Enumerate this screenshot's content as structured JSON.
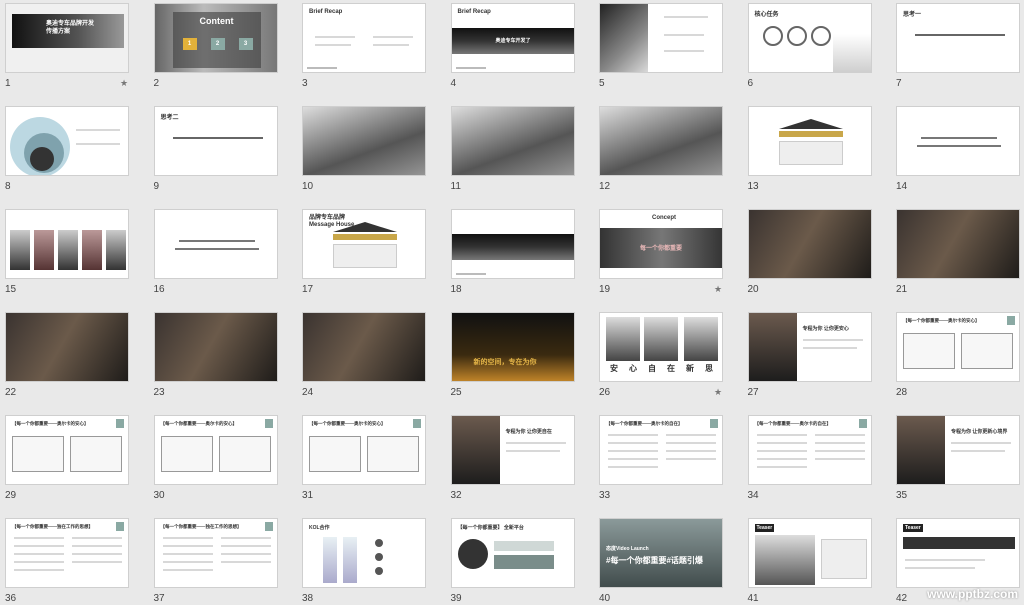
{
  "slides": [
    {
      "n": "1",
      "title": "奥迪专车品牌开发\n传播方案",
      "star": true,
      "kind": "cover"
    },
    {
      "n": "2",
      "title": "Content",
      "kind": "content",
      "items": [
        "1",
        "2",
        "3"
      ]
    },
    {
      "n": "3",
      "title": "Brief Recap",
      "kind": "brief"
    },
    {
      "n": "4",
      "title": "Brief Recap",
      "kind": "brief-car",
      "caption": "奥迪专车开发了"
    },
    {
      "n": "5",
      "kind": "photo-left"
    },
    {
      "n": "6",
      "title": "核心任务",
      "kind": "circles"
    },
    {
      "n": "7",
      "title": "思考一",
      "kind": "question"
    },
    {
      "n": "8",
      "kind": "venn"
    },
    {
      "n": "9",
      "title": "思考二",
      "kind": "question"
    },
    {
      "n": "10",
      "kind": "photo-gray"
    },
    {
      "n": "11",
      "kind": "photo-gray"
    },
    {
      "n": "12",
      "kind": "photo-gray"
    },
    {
      "n": "13",
      "kind": "house"
    },
    {
      "n": "14",
      "kind": "text-center"
    },
    {
      "n": "15",
      "kind": "photo-strip"
    },
    {
      "n": "16",
      "kind": "text-center"
    },
    {
      "n": "17",
      "title": "品牌专车品牌\nMessage House",
      "kind": "house2"
    },
    {
      "n": "18",
      "kind": "brief-car"
    },
    {
      "n": "19",
      "title": "Concept",
      "star": true,
      "kind": "concept",
      "caption": "每一个你都重要"
    },
    {
      "n": "20",
      "kind": "photo-dark"
    },
    {
      "n": "21",
      "kind": "photo-dark"
    },
    {
      "n": "22",
      "kind": "photo-dark"
    },
    {
      "n": "23",
      "kind": "photo-dark"
    },
    {
      "n": "24",
      "kind": "photo-dark"
    },
    {
      "n": "25",
      "kind": "photo-night",
      "caption": "新的空间，专在为你"
    },
    {
      "n": "26",
      "star": true,
      "kind": "portraits",
      "chars": [
        "安",
        "心",
        "自",
        "在",
        "新",
        "思"
      ]
    },
    {
      "n": "27",
      "kind": "photo-woman",
      "caption": "专程为你 让你更安心"
    },
    {
      "n": "28",
      "title": "【每一个你都重要——奥尔卡的安心】",
      "kind": "storyboard"
    },
    {
      "n": "29",
      "title": "【每一个你都重要——奥尔卡的安心】",
      "kind": "storyboard"
    },
    {
      "n": "30",
      "title": "【每一个你都重要——奥尔卡的安心】",
      "kind": "storyboard"
    },
    {
      "n": "31",
      "title": "【每一个你都重要——奥尔卡的安心】",
      "kind": "storyboard"
    },
    {
      "n": "32",
      "kind": "photo-man",
      "caption": "专程为你 让你更自在"
    },
    {
      "n": "33",
      "title": "【每一个你都重要——奥尔卡的自在】",
      "kind": "textpage"
    },
    {
      "n": "34",
      "title": "【每一个你都重要——奥尔卡的自在】",
      "kind": "textpage"
    },
    {
      "n": "35",
      "kind": "photo-man",
      "caption": "专程为你 让你更新心境界"
    },
    {
      "n": "36",
      "title": "【每一个你都重要——独在工作的思想】",
      "kind": "textpage"
    },
    {
      "n": "37",
      "title": "【每一个你都重要——独在工作的思想】",
      "kind": "textpage"
    },
    {
      "n": "38",
      "title": "KOL合作",
      "kind": "bottles"
    },
    {
      "n": "39",
      "title": "【每一个你都重要】 全新平台",
      "kind": "social"
    },
    {
      "n": "40",
      "kind": "launch",
      "caption": "#每一个你都重要#话题引爆",
      "sub": "态度Video Launch"
    },
    {
      "n": "41",
      "title": "Teaser",
      "kind": "teaser"
    },
    {
      "n": "42",
      "title": "Teaser",
      "kind": "teaser2"
    }
  ],
  "watermark": "www.pptbz.com"
}
